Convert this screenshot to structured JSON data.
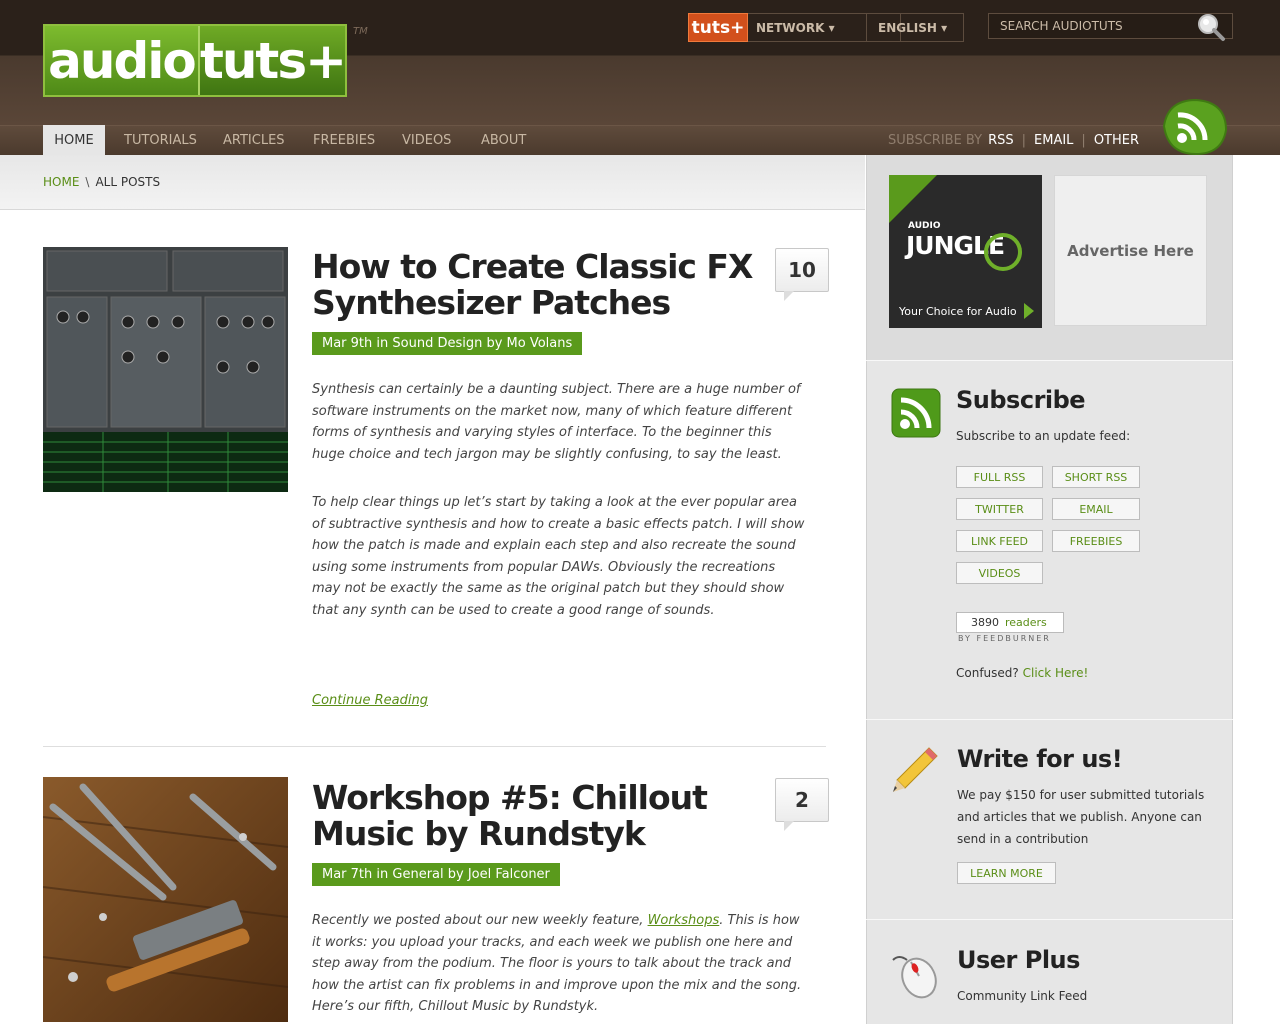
{
  "header": {
    "logo_left": "audio",
    "logo_right": "tuts+",
    "tm": "TM",
    "network_badge": "tuts+",
    "network_label": "NETWORK ▾",
    "language_label": "ENGLISH ▾",
    "search_placeholder": "SEARCH AUDIOTUTS"
  },
  "nav": {
    "items": [
      "HOME",
      "TUTORIALS",
      "ARTICLES",
      "FREEBIES",
      "VIDEOS",
      "ABOUT"
    ],
    "subscribe_label": "SUBSCRIBE BY",
    "subscribe_links": [
      "RSS",
      "EMAIL",
      "OTHER"
    ],
    "separator": "|"
  },
  "breadcrumb": {
    "home": "HOME",
    "sep": "\\",
    "current": "ALL POSTS"
  },
  "posts": [
    {
      "title": "How to Create Classic FX Synthesizer Patches",
      "meta": "Mar 9th in Sound Design by Mo Volans",
      "comments": "10",
      "paragraphs": [
        "Synthesis can certainly be a daunting subject. There are a huge number of software instruments on the market now, many of which feature different forms of synthesis and varying styles of interface. To the beginner this huge choice and tech jargon may be slightly confusing, to say the least.",
        "To help clear things up let’s start by taking a look at the ever popular area of subtractive synthesis and how to create a basic effects patch. I will show how the patch is made and explain each step and also recreate the sound using some instruments from popular DAWs. Obviously the recreations may not be exactly the same as the original patch but they should show that any synth can be used to create a good range of sounds."
      ],
      "continue": "Continue Reading"
    },
    {
      "title": "Workshop #5: Chillout Music by Rundstyk",
      "meta": "Mar 7th in General by Joel Falconer",
      "comments": "2",
      "excerpt_pre": "Recently we posted about our new weekly feature, ",
      "excerpt_link": "Workshops",
      "excerpt_post": ". This is how it works: you upload your tracks, and each week we publish one here and step away from the podium. The floor is yours to talk about the track and how the artist can fix problems in and improve upon the mix and the song. Here’s our fifth, Chillout Music by Rundstyk."
    }
  ],
  "sidebar": {
    "ad_jungle": {
      "small": "AUDIO",
      "big": "JUNGLE",
      "tagline": "Your Choice for Audio"
    },
    "ad_placeholder": "Advertise Here",
    "subscribe": {
      "title": "Subscribe",
      "text": "Subscribe to an update feed:",
      "buttons": [
        "FULL RSS",
        "SHORT RSS",
        "TWITTER",
        "EMAIL",
        "LINK FEED",
        "FREEBIES",
        "VIDEOS"
      ],
      "readers_count": "3890",
      "readers_label": "readers",
      "feedburner": "BY FEEDBURNER",
      "confused": "Confused?",
      "click_here": "Click Here!"
    },
    "write": {
      "title": "Write for us!",
      "text": "We pay $150 for user submitted tutorials and articles that we publish. Anyone can send in a contribution",
      "button": "LEARN MORE"
    },
    "userplus": {
      "title": "User Plus",
      "text": "Community Link Feed"
    }
  }
}
